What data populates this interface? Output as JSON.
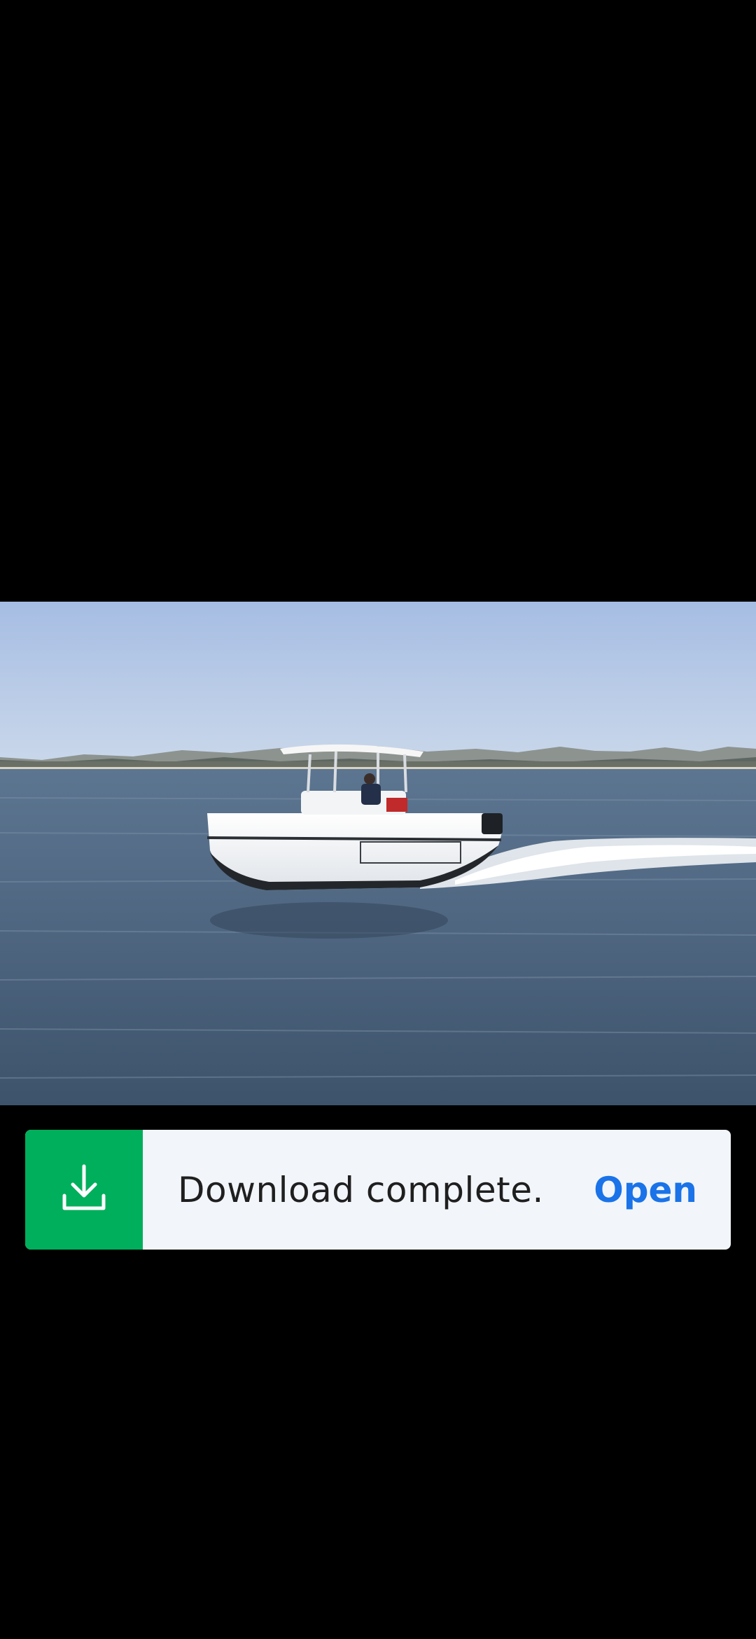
{
  "viewer": {
    "background_color": "#000000"
  },
  "photo": {
    "subject": "boat-on-lake-photo"
  },
  "snackbar": {
    "icon": "download-icon",
    "icon_bg_color": "#00af5b",
    "message": "Download complete.",
    "action_label": "Open",
    "action_color": "#1a73e8"
  }
}
